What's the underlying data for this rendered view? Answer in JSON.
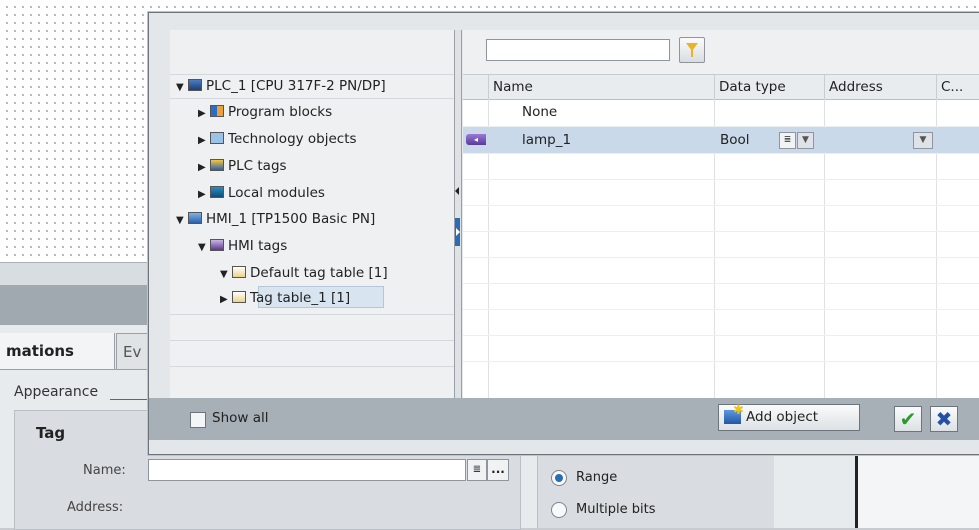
{
  "dialog": {
    "tree": {
      "plc": "PLC_1 [CPU 317F-2 PN/DP]",
      "program_blocks": "Program blocks",
      "technology_objects": "Technology objects",
      "plc_tags": "PLC tags",
      "local_modules": "Local modules",
      "hmi": "HMI_1 [TP1500 Basic PN]",
      "hmi_tags": "HMI tags",
      "default_tag_table": "Default tag table [1]",
      "tag_table_1": "Tag table_1 [1]"
    },
    "filter": {
      "value": ""
    },
    "grid": {
      "columns": [
        "Name",
        "Data type",
        "Address",
        "C..."
      ],
      "rows": [
        {
          "name": "None",
          "data_type": "",
          "address": ""
        },
        {
          "name": "lamp_1",
          "data_type": "Bool",
          "address": ""
        }
      ]
    },
    "footer": {
      "show_all": "Show all",
      "add_object": "Add object"
    }
  },
  "inspector": {
    "tabs": [
      "mations",
      "Ev"
    ],
    "appearance": "Appearance",
    "tag_group_title": "Tag",
    "name_label": "Name:",
    "address_label": "Address:",
    "name_value": "",
    "range_label": "Range",
    "multiple_bits_label": "Multiple bits"
  },
  "icons": {
    "expand": "▶",
    "collapse": "▼",
    "ok": "✔",
    "cancel": "✖",
    "ellipsis": "...",
    "list": "≣",
    "dropdown": "▼"
  }
}
